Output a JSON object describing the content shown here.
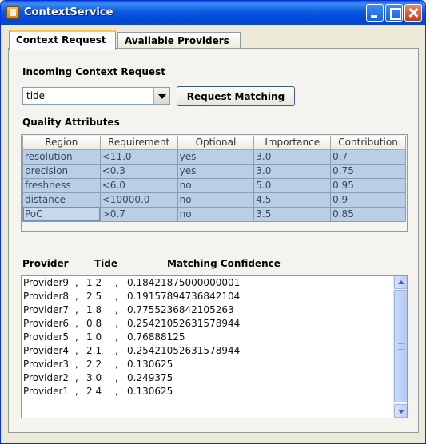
{
  "window": {
    "title": "ContextService",
    "controls": [
      "minimize-icon",
      "maximize-icon",
      "close-icon"
    ]
  },
  "tabs": [
    {
      "label": "Context Request",
      "active": true
    },
    {
      "label": "Available Providers",
      "active": false
    }
  ],
  "request": {
    "section_label": "Incoming Context Request",
    "selected_value": "tide",
    "button_label": "Request Matching"
  },
  "quality": {
    "section_label": "Quality Attributes",
    "columns": [
      "Region",
      "Requirement",
      "Optional",
      "Importance",
      "Contribution"
    ],
    "rows": [
      [
        "resolution",
        "<11.0",
        "yes",
        "3.0",
        "0.7"
      ],
      [
        "precision",
        "<0.3",
        "yes",
        "3.0",
        "0.75"
      ],
      [
        "freshness",
        "<6.0",
        "no",
        "5.0",
        "0.95"
      ],
      [
        "distance",
        "<10000.0",
        "no",
        "4.5",
        "0.9"
      ],
      [
        "PoC",
        ">0.7",
        "no",
        "3.5",
        "0.85"
      ]
    ]
  },
  "results": {
    "headers": {
      "provider": "Provider",
      "tide": "Tide",
      "confidence": "Matching Confidence"
    },
    "separator": ",",
    "rows": [
      [
        "Provider9",
        "1.2",
        "0.18421875000000001"
      ],
      [
        "Provider8",
        "2.5",
        "0.19157894736842104"
      ],
      [
        "Provider7",
        "1.8",
        "0.7755236842105263"
      ],
      [
        "Provider6",
        "0.8",
        "0.25421052631578944"
      ],
      [
        "Provider5",
        "1.0",
        "0.76888125"
      ],
      [
        "Provider4",
        "2.1",
        "0.25421052631578944"
      ],
      [
        "Provider3",
        "2.2",
        "0.130625"
      ],
      [
        "Provider2",
        "3.0",
        "0.249375"
      ],
      [
        "Provider1",
        "2.4",
        "0.130625"
      ]
    ]
  }
}
